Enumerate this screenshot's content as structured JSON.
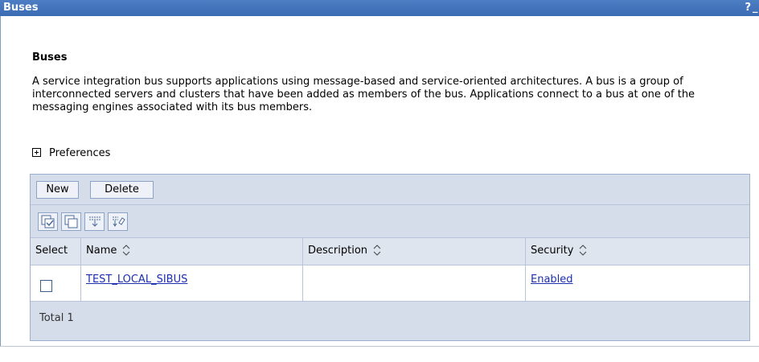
{
  "window": {
    "title": "Buses",
    "help_label": "?",
    "minimize_label": "_"
  },
  "main": {
    "heading": "Buses",
    "description": "A service integration bus supports applications using message-based and service-oriented architectures. A bus is a group of interconnected servers and clusters that have been added as members of the bus. Applications connect to a bus at one of the messaging engines associated with its bus members.",
    "preferences_label": "Preferences"
  },
  "toolbar": {
    "new_label": "New",
    "delete_label": "Delete"
  },
  "tools": [
    {
      "icon": "select-all-icon"
    },
    {
      "icon": "deselect-all-icon"
    },
    {
      "icon": "show-filter-icon"
    },
    {
      "icon": "clear-filter-icon"
    }
  ],
  "table": {
    "columns": [
      "Select",
      "Name",
      "Description",
      "Security"
    ],
    "rows": [
      {
        "selected": false,
        "name": "TEST_LOCAL_SIBUS",
        "description": "",
        "security": "Enabled"
      }
    ],
    "total_label": "Total 1"
  },
  "colors": {
    "title_bar": "#3b6bb3",
    "panel": "#d5dcea",
    "link": "#1b2fb0"
  }
}
